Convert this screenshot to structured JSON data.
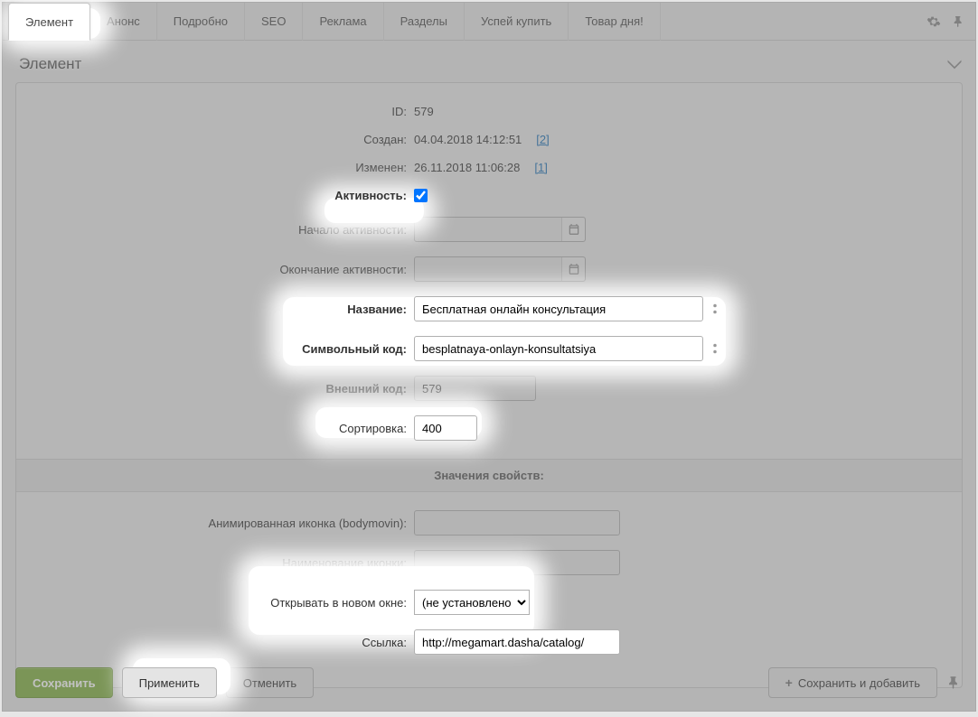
{
  "tabs": {
    "items": [
      "Элемент",
      "Анонс",
      "Подробно",
      "SEO",
      "Реклама",
      "Разделы",
      "Успей купить",
      "Товар дня!"
    ],
    "active_index": 0
  },
  "panel": {
    "title": "Элемент"
  },
  "meta": {
    "id_label": "ID:",
    "id_value": "579",
    "created_label": "Создан:",
    "created_value": "04.04.2018 14:12:51",
    "created_user": "[2]",
    "modified_label": "Изменен:",
    "modified_value": "26.11.2018 11:06:28",
    "modified_user": "[1]"
  },
  "fields": {
    "active_label": "Активность:",
    "active_checked": true,
    "start_label": "Начало активности:",
    "start_value": "",
    "end_label": "Окончание активности:",
    "end_value": "",
    "name_label": "Название:",
    "name_value": "Бесплатная онлайн консультация",
    "symcode_label": "Символьный код:",
    "symcode_value": "besplatnaya-onlayn-konsultatsiya",
    "extcode_label": "Внешний код:",
    "extcode_value": "579",
    "sort_label": "Сортировка:",
    "sort_value": "400"
  },
  "props_header": "Значения свойств:",
  "props": {
    "anim_icon_label": "Анимированная иконка (bodymovin):",
    "anim_icon_value": "",
    "icon_name_label": "Наименование иконки:",
    "icon_name_value": "",
    "new_window_label": "Открывать в новом окне:",
    "new_window_value": "(не установлено)",
    "link_label": "Ссылка:",
    "link_value": "http://megamart.dasha/catalog/"
  },
  "buttons": {
    "save": "Сохранить",
    "apply": "Применить",
    "cancel": "Отменить",
    "save_add": "Сохранить и добавить"
  }
}
